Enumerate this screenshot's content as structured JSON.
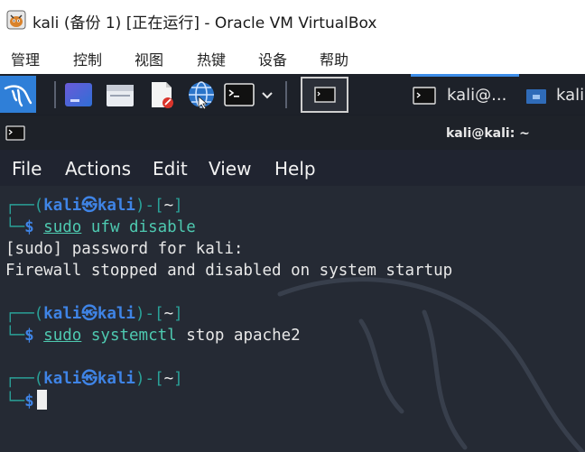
{
  "window": {
    "title": "kali (备份 1) [正在运行] - Oracle VM VirtualBox"
  },
  "vbox_menu": [
    "管理",
    "控制",
    "视图",
    "热键",
    "设备",
    "帮助"
  ],
  "panel": {
    "tasks": [
      {
        "label": "kali@...",
        "icon": "terminal-icon",
        "active": true
      },
      {
        "label": "kali",
        "icon": "folder-icon",
        "active": false
      }
    ]
  },
  "terminal": {
    "title": "kali@kali: ~",
    "menu": [
      "File",
      "Actions",
      "Edit",
      "View",
      "Help"
    ],
    "prompt": {
      "open": "┌──(",
      "user": "kali",
      "at": "㉿",
      "host": "kali",
      "close": ")-[",
      "path": "~",
      "end": "]",
      "corner": "└─",
      "symbol": "$"
    },
    "blocks": [
      {
        "sudo": "sudo",
        "command": "ufw disable",
        "output": [
          "[sudo] password for kali:",
          "Firewall stopped and disabled on system startup"
        ]
      },
      {
        "sudo": "sudo",
        "command_name": "systemctl",
        "command_args": "stop apache2",
        "output": []
      },
      {
        "command": "",
        "output": []
      }
    ]
  },
  "colors": {
    "panel_accent": "#2f7fd8",
    "prompt_blue": "#3f84e6",
    "prompt_frame": "#2aa198",
    "command_cyan": "#4ec9b0",
    "terminal_bg": "#252a34"
  }
}
